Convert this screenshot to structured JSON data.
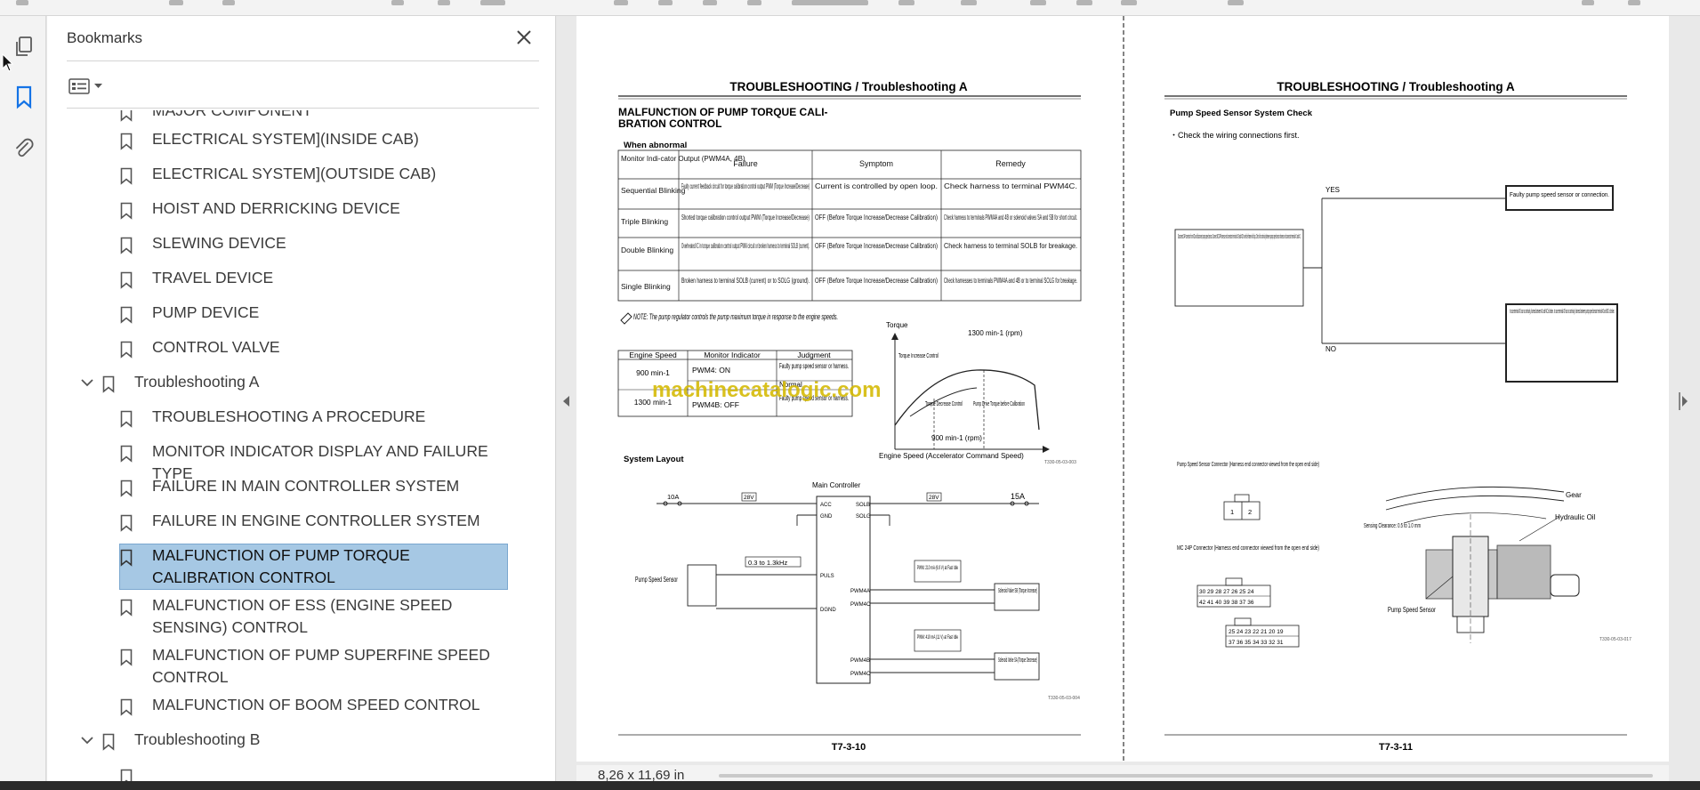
{
  "panel": {
    "title": "Bookmarks"
  },
  "bookmarks": [
    {
      "label": "MAJOR COMPONENT"
    },
    {
      "label": "ELECTRICAL SYSTEM](INSIDE CAB)"
    },
    {
      "label": "ELECTRICAL SYSTEM](OUTSIDE CAB)"
    },
    {
      "label": "HOIST AND DERRICKING DEVICE"
    },
    {
      "label": "SLEWING DEVICE"
    },
    {
      "label": "TRAVEL DEVICE"
    },
    {
      "label": "PUMP DEVICE"
    },
    {
      "label": "CONTROL VALVE"
    },
    {
      "label": "Troubleshooting A"
    },
    {
      "label": "TROUBLESHOOTING A PROCEDURE"
    },
    {
      "label": "MONITOR INDICATOR DISPLAY AND FAILURE TYPE"
    },
    {
      "label": "FAILURE IN MAIN CONTROLLER SYSTEM"
    },
    {
      "label": "FAILURE IN ENGINE CONTROLLER SYSTEM"
    },
    {
      "label": "MALFUNCTION OF PUMP TORQUE CALIBRATION CONTROL"
    },
    {
      "label": "MALFUNCTION OF ESS (ENGINE SPEED SENSING) CONTROL"
    },
    {
      "label": "MALFUNCTION OF PUMP SUPERFINE SPEED CONTROL"
    },
    {
      "label": "MALFUNCTION OF BOOM SPEED CONTROL"
    },
    {
      "label": "Troubleshooting B"
    }
  ],
  "status": {
    "page_size": "8,26 x 11,69 in"
  },
  "doc": {
    "left": {
      "header": "TROUBLESHOOTING / Troubleshooting A",
      "title1": "MALFUNCTION OF PUMP TORQUE CALI-",
      "title2": "BRATION CONTROL",
      "when_abnormal": "When abnormal",
      "table_headers": [
        "Monitor Indi-cator Output (PWM4A, 4B)",
        "Failure",
        "Symptom",
        "Remedy"
      ],
      "table_rows": [
        [
          "Sequential Blinking",
          "Faulty current feedback circuit for torque calibration control output PWM (Torque Increase/Decrease)",
          "Current is controlled by open loop.",
          "Check harness to terminal PWM4C."
        ],
        [
          "Triple Blinking",
          "Shorted torque calibration control output PWM (Torque Increase/Decrease)",
          "OFF (Before Torque Increase/Decrease Calibration)",
          "Check harness to terminals PWM4A and 4B or solenoid valves SA and SB for short circuit."
        ],
        [
          "Double Blinking",
          "Overheated IC in torque calibration control output PWM circuit or broken harness to terminal SOLB (current).",
          "OFF (Before Torque Increase/Decrease Calibration)",
          "Check harness to terminal SOLB for breakage."
        ],
        [
          "Single Blinking",
          "Broken harness to terminal SOLB (current) or to SOLG (ground).",
          "OFF (Before Torque Increase/Decrease Calibration)",
          "Check harnesses to terminals PWM4A and 4B or to terminal SOLG for breakage."
        ]
      ],
      "note": "NOTE: The pump regulator controls the pump maximum torque in response to the engine speeds.",
      "eng_headers": [
        "Engine Speed",
        "Monitor Indicator",
        "Judgment"
      ],
      "eng_rows": [
        [
          "900 min-1",
          "PWM4: ON",
          "Faulty pump speed sensor or harness."
        ],
        [
          "",
          "",
          "Normal"
        ],
        [
          "1300 min-1",
          "PWM4B: OFF",
          "Faulty pump speed sensor or harness."
        ]
      ],
      "graph_y": "Torque",
      "graph_x": "Engine Speed (Accelerator Command Speed)",
      "graph_rpm_top": "1300 min-1 (rpm)",
      "graph_rpm_bottom": "900 min-1 (rpm)",
      "graph_l1": "Torque Increase Control",
      "graph_l2": "Torque Decrease Control",
      "graph_l3": "Pump Drive Torque before Calibration",
      "system_layout": "System Layout",
      "main_controller": "Main Controller",
      "pump_speed_sensor": "Pump Speed Sensor",
      "freq": "0.3 to 1.3kHz",
      "pwm1": "PWM: 210 mA (6.9 V) at Fast Idle",
      "pwm2": "PWM: 410 mA (11 V) at Fast Idle",
      "sol_sb": "Solenoid Valve SB (Torque Increase)",
      "sol_sa": "Solenoid Valve SA (Torque Decrease)",
      "page_no": "T7-3-10",
      "watermark": "machinecatalogic.com"
    },
    "right": {
      "header": "TROUBLESHOOTING / Troubleshooting A",
      "subtitle": "Pump Speed Sensor System Check",
      "bullet": "・Check the wiring connections first.",
      "yes": "YES",
      "no": "NO",
      "check_box": "Disconnect 24P connector from MC and disconnect pump speed sensor. Connect MC 24P harness end connector terminals #19 and #20 to vehicle frame with clips. Check for continuity between pump speed sensor harness end connector terminal #1 and #2.",
      "yes_box": "Faulty pump speed sensor or connection.",
      "no_box": "In case terminal #1 has no continuity, harness between #1 and MC is broken. In case terminal #2 has no continuity, harness between pump speed sensor terminal #2 and MC is broken.",
      "conn1": "Pump Speed Sensor Connector (Harness end connector viewed from the open end side)",
      "conn2": "MC 24P Connector (Harness end connector viewed from the open end side)",
      "gear": "Gear",
      "oil": "Hydraulic Oil",
      "clearance": "Sensing Clearance: 0.5 to 1.0 mm",
      "sensor": "Pump Speed Sensor",
      "page_no": "T7-3-11"
    }
  }
}
